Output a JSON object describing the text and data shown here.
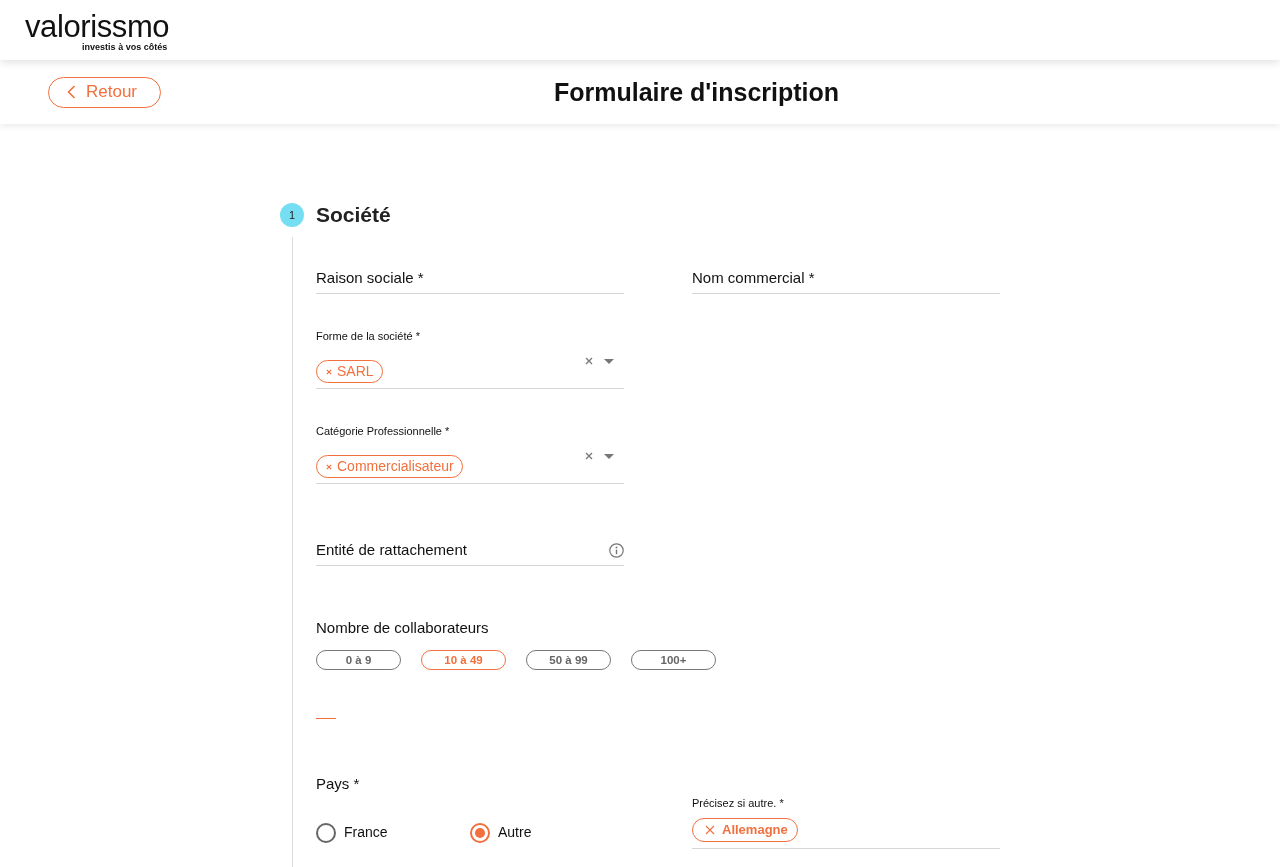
{
  "header": {
    "logo": "valorissmo",
    "tagline": "investis à vos côtés"
  },
  "toolbar": {
    "back_button": "Retour",
    "title": "Formulaire d'inscription"
  },
  "section": {
    "number": "1",
    "title": "Société",
    "rows": [
      {
        "fields": [
          {
            "kind": "text",
            "label": "Raison sociale *"
          },
          {
            "kind": "text",
            "label": "Nom commercial *"
          }
        ]
      },
      {
        "fields": [
          {
            "kind": "select",
            "label": "Forme de la société *",
            "tags": [
              "SARL"
            ]
          }
        ]
      },
      {
        "fields": [
          {
            "kind": "select",
            "label": "Catégorie Professionnelle *",
            "tags": [
              "Commercialisateur"
            ]
          }
        ]
      },
      {
        "fields": [
          {
            "kind": "text",
            "label": "Entité de rattachement",
            "info": true
          }
        ]
      },
      {
        "fields": [
          {
            "kind": "choices",
            "label": "Nombre de collaborateurs",
            "options": [
              {
                "label": "0 à 9",
                "selected": false
              },
              {
                "label": "10 à 49",
                "selected": true
              },
              {
                "label": "50 à 99",
                "selected": false
              },
              {
                "label": "100+",
                "selected": false
              }
            ]
          }
        ]
      },
      {
        "fields": [
          {
            "kind": "separator"
          }
        ]
      },
      {
        "fields": [
          {
            "kind": "radios",
            "label": "Pays *",
            "options": [
              {
                "label": "France",
                "selected": false
              },
              {
                "label": "Autre",
                "selected": true
              }
            ]
          },
          {
            "kind": "tags",
            "label": "Précisez si autre. *",
            "tags": [
              "Allemagne"
            ]
          }
        ]
      }
    ]
  }
}
